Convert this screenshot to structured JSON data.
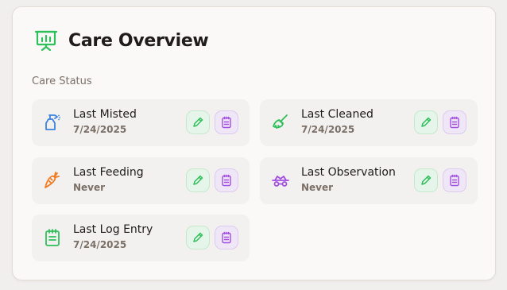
{
  "header": {
    "title": "Care Overview",
    "icon": "presentation-chart-icon",
    "accent_color": "#2fbf5b"
  },
  "section": {
    "label": "Care Status"
  },
  "items": [
    {
      "id": "misted",
      "label": "Last Misted",
      "value": "7/24/2025",
      "icon": "spray-bottle-icon",
      "icon_color": "#3b82e0"
    },
    {
      "id": "cleaned",
      "label": "Last Cleaned",
      "value": "7/24/2025",
      "icon": "broom-icon",
      "icon_color": "#2fbf5b"
    },
    {
      "id": "feeding",
      "label": "Last Feeding",
      "value": "Never",
      "icon": "carrot-icon",
      "icon_color": "#f07a1f"
    },
    {
      "id": "observation",
      "label": "Last Observation",
      "value": "Never",
      "icon": "observation-glasses-icon",
      "icon_color": "#a24fe0"
    },
    {
      "id": "log",
      "label": "Last Log Entry",
      "value": "7/24/2025",
      "icon": "notepad-icon",
      "icon_color": "#2fbf5b"
    }
  ],
  "actions": {
    "edit_icon": "pencil-icon",
    "edit_color": "#2fbf5b",
    "log_icon": "notepad-icon",
    "log_color": "#a24fe0"
  }
}
